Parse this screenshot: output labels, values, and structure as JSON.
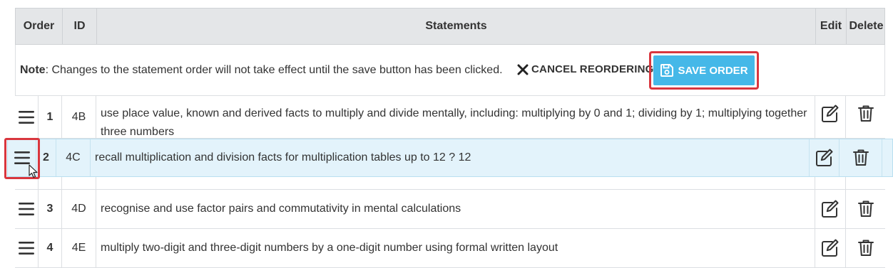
{
  "header": {
    "order": "Order",
    "id": "ID",
    "statements": "Statements",
    "edit": "Edit",
    "delete": "Delete"
  },
  "note": {
    "label": "Note",
    "text": ": Changes to the statement order will not take effect until the save button has been clicked.",
    "cancel_label": "CANCEL REORDERING",
    "save_label": "SAVE ORDER"
  },
  "rows": [
    {
      "order": "1",
      "id": "4B",
      "statement": "use place value, known and derived facts to multiply and divide mentally, including: multiplying by 0 and 1; dividing by 1; multiplying together three numbers"
    },
    {
      "order": "2",
      "id": "4C",
      "statement": "recall multiplication and division facts for multiplication tables up to 12 ? 12"
    },
    {
      "order": "3",
      "id": "4D",
      "statement": "recognise and use factor pairs and commutativity in mental calculations"
    },
    {
      "order": "4",
      "id": "4E",
      "statement": "multiply two-digit and three-digit numbers by a one-digit number using formal written layout"
    }
  ],
  "icons": {
    "drag": "drag-handle-icon",
    "edit": "edit-icon",
    "delete": "trash-icon",
    "save": "floppy-disk-icon",
    "cancel": "close-icon"
  },
  "colors": {
    "save_button": "#45b8e8",
    "highlight": "#d9363e",
    "drag_row": "#e3f3fb"
  }
}
